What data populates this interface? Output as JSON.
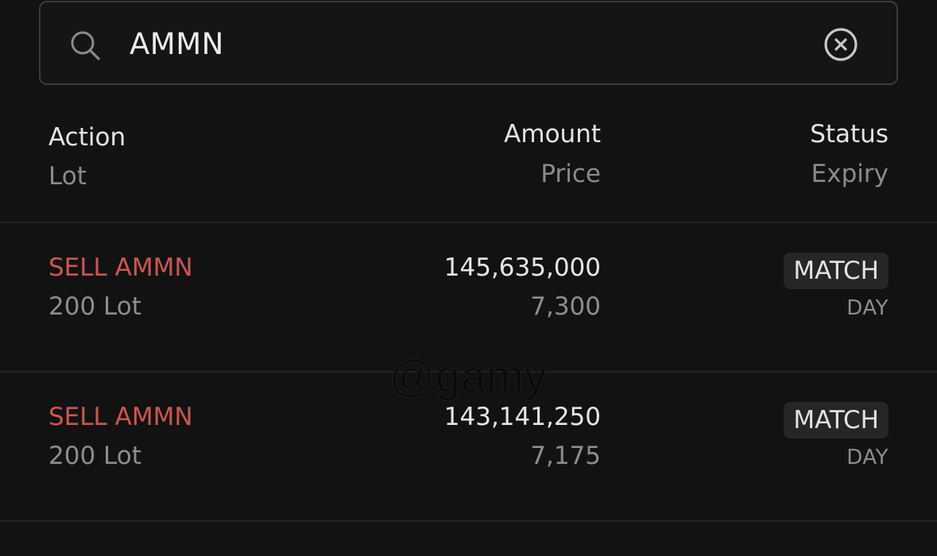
{
  "search": {
    "value": "AMMN",
    "icon": "search-icon",
    "clear_icon": "clear-circle-x-icon"
  },
  "header": {
    "action": "Action",
    "lot": "Lot",
    "amount": "Amount",
    "price": "Price",
    "status": "Status",
    "expiry": "Expiry"
  },
  "orders": [
    {
      "action": "SELL AMMN",
      "lot": "200 Lot",
      "amount": "145,635,000",
      "price": "7,300",
      "status": "MATCH",
      "expiry": "DAY"
    },
    {
      "action": "SELL AMMN",
      "lot": "200 Lot",
      "amount": "143,141,250",
      "price": "7,175",
      "status": "MATCH",
      "expiry": "DAY"
    }
  ],
  "watermark": "@gamy",
  "colors": {
    "background": "#121212",
    "sell": "#cf5450",
    "badge_bg": "#262626",
    "muted": "#8d8d8d"
  }
}
